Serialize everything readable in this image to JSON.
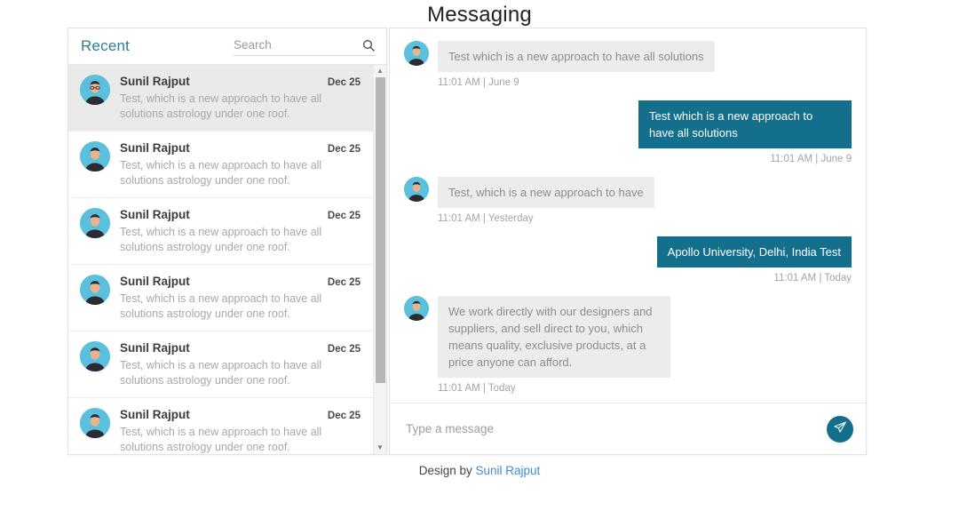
{
  "page": {
    "title": "Messaging"
  },
  "sidebar": {
    "heading": "Recent",
    "search": {
      "placeholder": "Search",
      "value": "",
      "icon": "search-icon"
    },
    "scrollbar": {
      "up_arrow": "▲",
      "down_arrow": "▼"
    },
    "items": [
      {
        "name": "Sunil Rajput",
        "date": "Dec 25",
        "preview": "Test, which is a new approach to have all solutions astrology under one roof.",
        "selected": true
      },
      {
        "name": "Sunil Rajput",
        "date": "Dec 25",
        "preview": "Test, which is a new approach to have all solutions astrology under one roof.",
        "selected": false
      },
      {
        "name": "Sunil Rajput",
        "date": "Dec 25",
        "preview": "Test, which is a new approach to have all solutions astrology under one roof.",
        "selected": false
      },
      {
        "name": "Sunil Rajput",
        "date": "Dec 25",
        "preview": "Test, which is a new approach to have all solutions astrology under one roof.",
        "selected": false
      },
      {
        "name": "Sunil Rajput",
        "date": "Dec 25",
        "preview": "Test, which is a new approach to have all solutions astrology under one roof.",
        "selected": false
      },
      {
        "name": "Sunil Rajput",
        "date": "Dec 25",
        "preview": "Test, which is a new approach to have all solutions astrology under one roof.",
        "selected": false
      }
    ]
  },
  "conversation": {
    "messages": [
      {
        "direction": "in",
        "text": "Test which is a new approach to have all solutions",
        "time": "11:01 AM | June 9"
      },
      {
        "direction": "out",
        "text": "Test which is a new approach to have all solutions",
        "time": "11:01 AM | June 9"
      },
      {
        "direction": "in",
        "text": "Test, which is a new approach to have",
        "time": "11:01 AM | Yesterday"
      },
      {
        "direction": "out",
        "text": "Apollo University, Delhi, India Test",
        "time": "11:01 AM | Today"
      },
      {
        "direction": "in",
        "text": "We work directly with our designers and suppliers, and sell direct to you, which means quality, exclusive products, at a price anyone can afford.",
        "time": "11:01 AM | Today"
      }
    ],
    "composer": {
      "placeholder": "Type a message",
      "value": "",
      "send_icon": "send-icon"
    }
  },
  "footer": {
    "prefix": "Design by ",
    "link": "Sunil Rajput"
  },
  "colors": {
    "accent": "#136f8b",
    "heading": "#2e7d94",
    "incoming_bubble": "#ececec",
    "avatar_bg": "#5bc0de",
    "link": "#3f8fd2"
  }
}
